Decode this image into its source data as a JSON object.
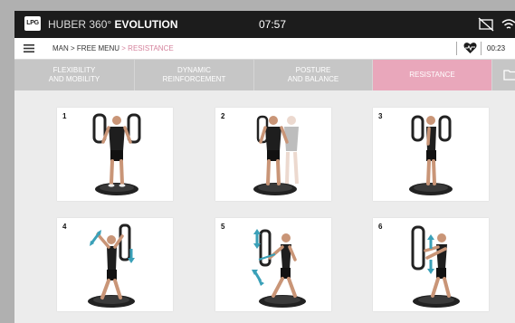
{
  "status_bar": {
    "logo": "LPG",
    "app_name_light": "HUBER 360°",
    "app_name_bold": "EVOLUTION",
    "time": "07:57",
    "icons": [
      "screen-off-icon",
      "wifi-icon"
    ]
  },
  "nav": {
    "menu_icon": "hamburger-menu-icon",
    "breadcrumb": {
      "part1": "MAN >",
      "part2": "FREE MENU",
      "part3": "> RESISTANCE"
    },
    "heart_icon": "heart-monitor-icon",
    "timer": "00:23"
  },
  "tabs": [
    {
      "label": "FLEXIBILITY\nAND MOBILITY",
      "active": false
    },
    {
      "label": "DYNAMIC\nREINFORCEMENT",
      "active": false
    },
    {
      "label": "POSTURE\nAND BALANCE",
      "active": false
    },
    {
      "label": "RESISTANCE",
      "active": true
    }
  ],
  "exercises": [
    {
      "number": "1",
      "pose": "back-view-standing"
    },
    {
      "number": "2",
      "pose": "back-view-motion-blur"
    },
    {
      "number": "3",
      "pose": "side-view-standing"
    },
    {
      "number": "4",
      "pose": "side-view-arm-raise"
    },
    {
      "number": "5",
      "pose": "lunge-pull"
    },
    {
      "number": "6",
      "pose": "front-view-push"
    }
  ],
  "colors": {
    "accent_pink": "#e9a7bb",
    "breadcrumb_active": "#d5829c",
    "status_bar": "#1c1c1c",
    "arrow_teal": "#3aa0b8",
    "tab_gray": "#c6c6c6"
  }
}
